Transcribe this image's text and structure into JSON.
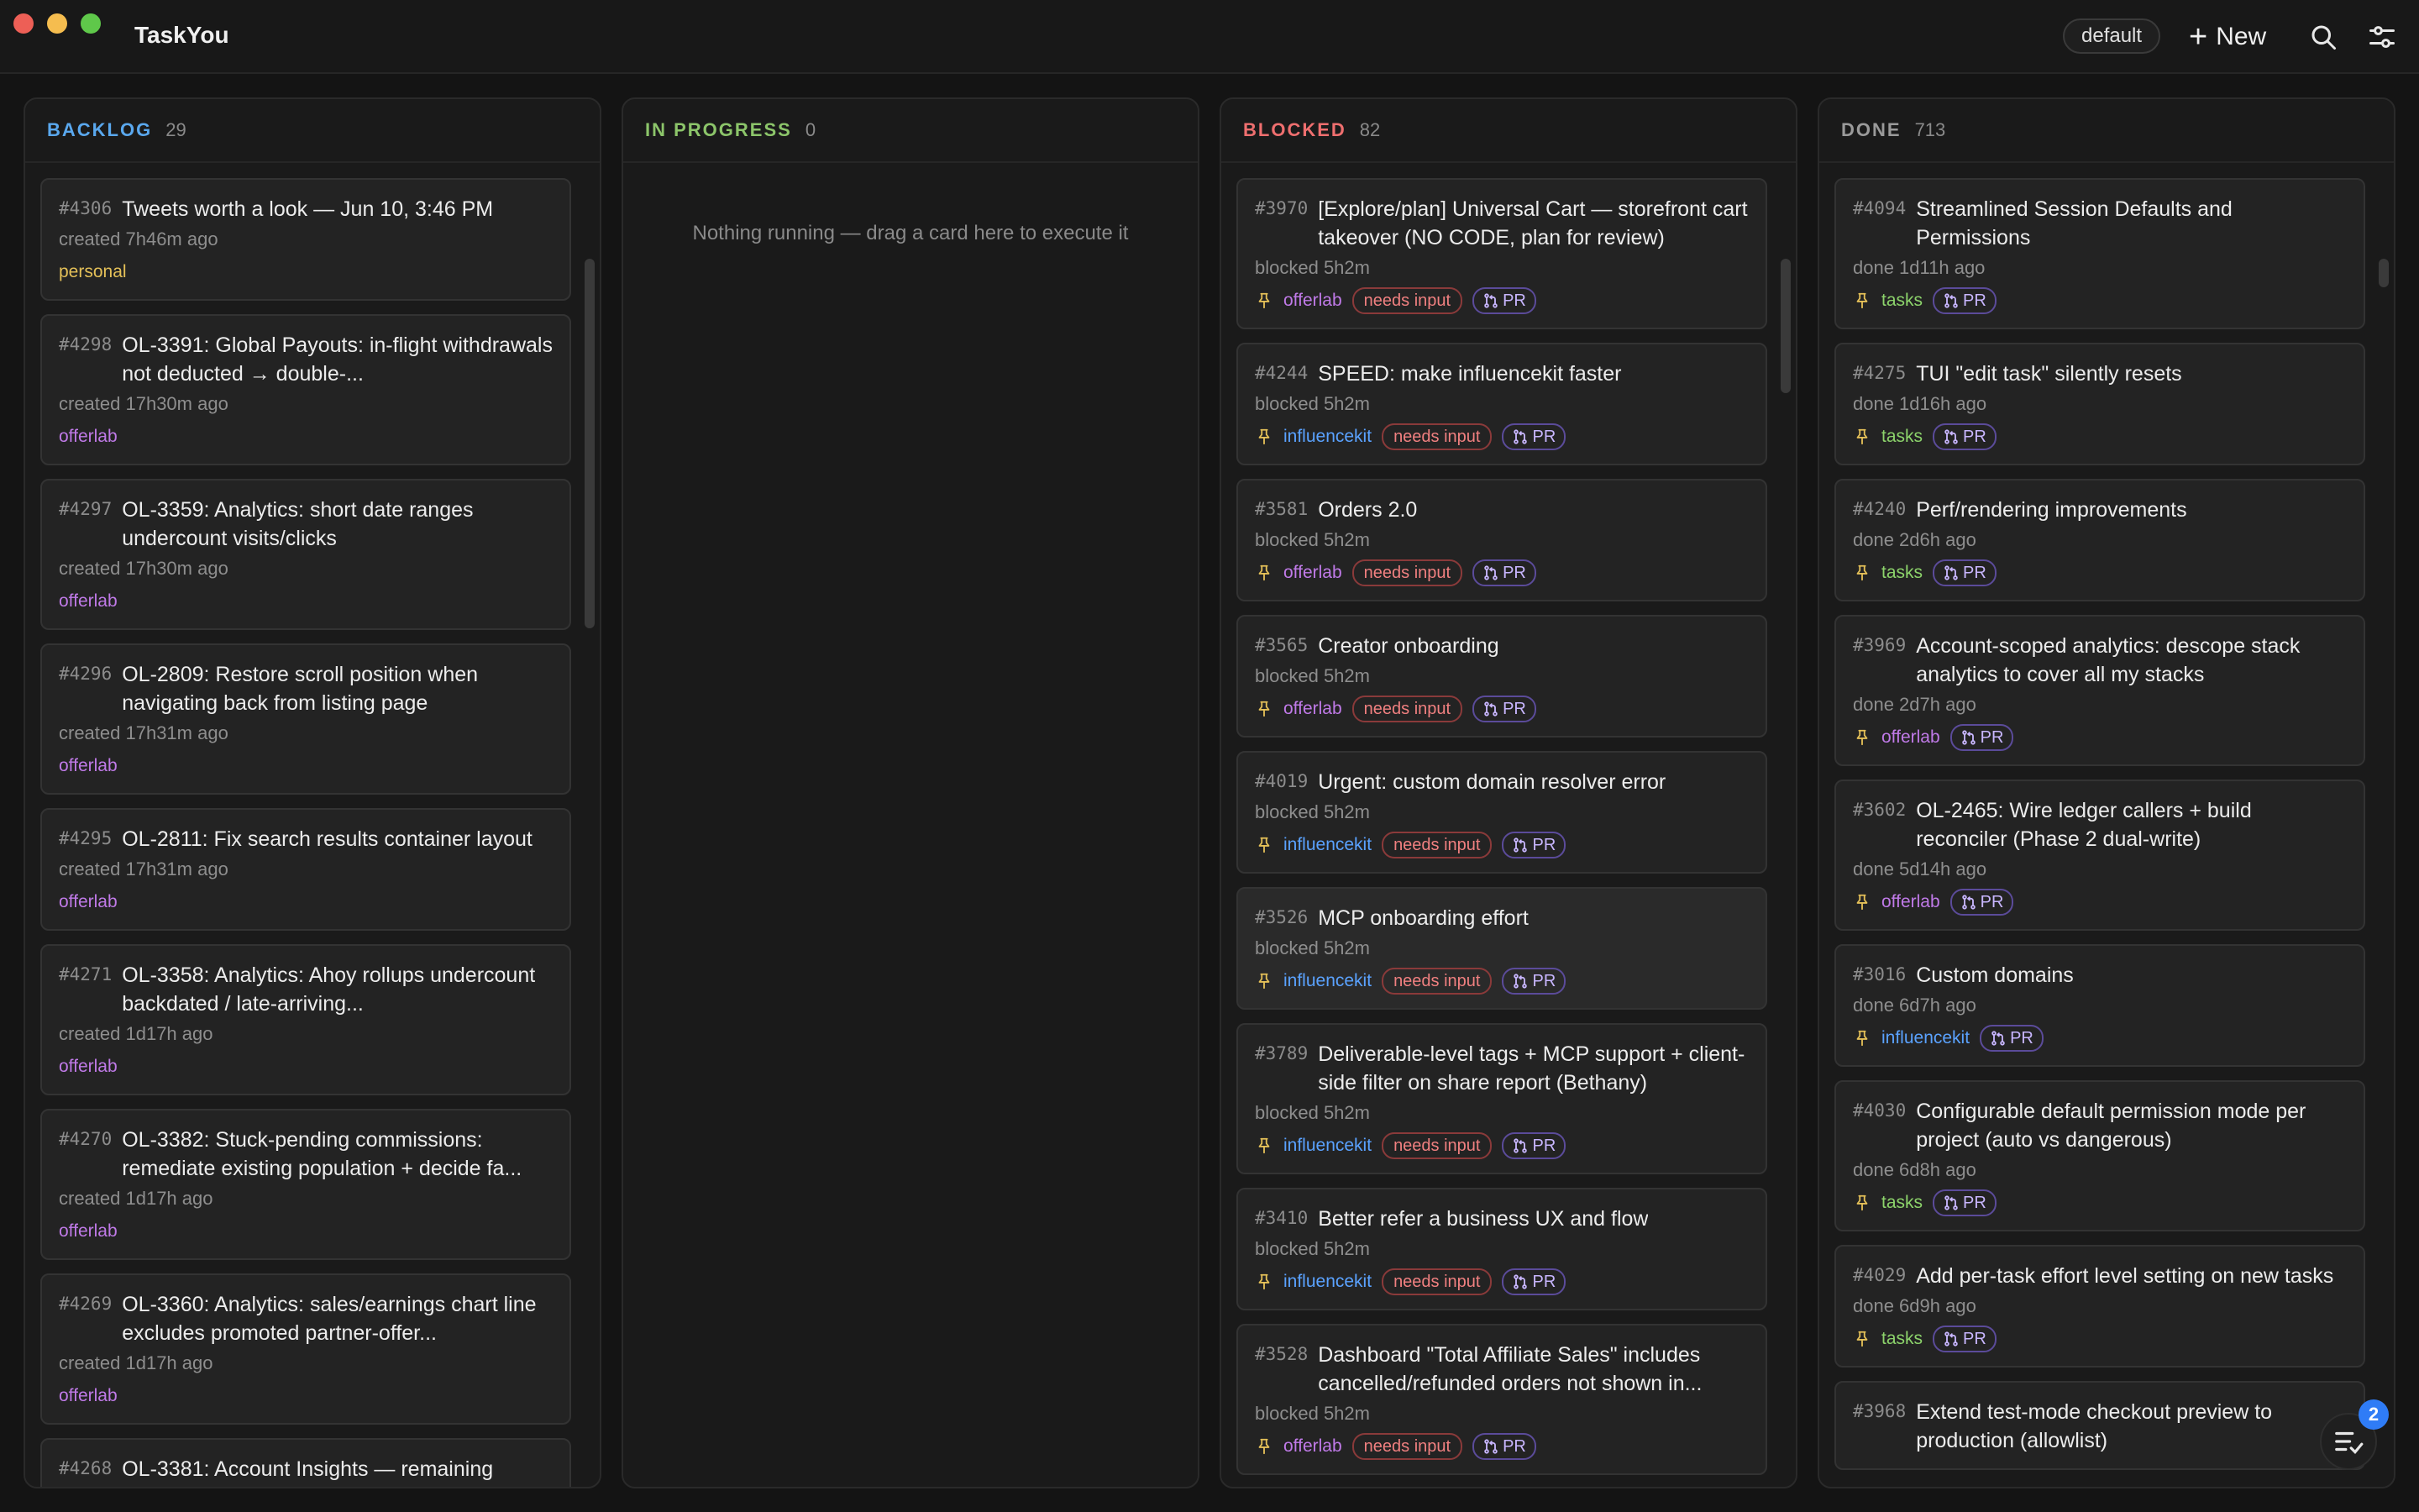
{
  "app": {
    "title": "TaskYou"
  },
  "toolbar": {
    "profile": "default",
    "new_label": "New"
  },
  "columns": {
    "backlog": {
      "title": "BACKLOG",
      "count": "29",
      "color": "#5aa8ee",
      "cards": [
        {
          "id": "#4306",
          "title": "Tweets worth a look — Jun 10, 3:46 PM",
          "meta": "created 7h46m ago",
          "project": "personal"
        },
        {
          "id": "#4298",
          "title": "OL-3391: Global Payouts: in-flight withdrawals not deducted → double-...",
          "meta": "created 17h30m ago",
          "project": "offerlab"
        },
        {
          "id": "#4297",
          "title": "OL-3359: Analytics: short date ranges undercount visits/clicks",
          "meta": "created 17h30m ago",
          "project": "offerlab"
        },
        {
          "id": "#4296",
          "title": "OL-2809: Restore scroll position when navigating back from listing page",
          "meta": "created 17h31m ago",
          "project": "offerlab"
        },
        {
          "id": "#4295",
          "title": "OL-2811: Fix search results container layout",
          "meta": "created 17h31m ago",
          "project": "offerlab"
        },
        {
          "id": "#4271",
          "title": "OL-3358: Analytics: Ahoy rollups undercount backdated / late-arriving...",
          "meta": "created 1d17h ago",
          "project": "offerlab"
        },
        {
          "id": "#4270",
          "title": "OL-3382: Stuck-pending commissions: remediate existing population + decide fa...",
          "meta": "created 1d17h ago",
          "project": "offerlab"
        },
        {
          "id": "#4269",
          "title": "OL-3360: Analytics: sales/earnings chart line excludes promoted partner-offer...",
          "meta": "created 1d17h ago",
          "project": "offerlab"
        },
        {
          "id": "#4268",
          "title": "OL-3381: Account Insights — remaining",
          "meta": "",
          "project": ""
        }
      ]
    },
    "in_progress": {
      "title": "IN PROGRESS",
      "count": "0",
      "color": "#8cc56a",
      "empty": "Nothing running — drag a card here to execute it"
    },
    "blocked": {
      "title": "BLOCKED",
      "count": "82",
      "color": "#ef6f6f",
      "needs_input_label": "needs input",
      "pr_label": "PR",
      "cards": [
        {
          "id": "#3970",
          "title": "[Explore/plan] Universal Cart — storefront cart takeover (NO CODE, plan for review)",
          "meta": "blocked 5h2m",
          "project": "offerlab"
        },
        {
          "id": "#4244",
          "title": "SPEED: make influencekit faster",
          "meta": "blocked 5h2m",
          "project": "influencekit"
        },
        {
          "id": "#3581",
          "title": "Orders 2.0",
          "meta": "blocked 5h2m",
          "project": "offerlab"
        },
        {
          "id": "#3565",
          "title": "Creator onboarding",
          "meta": "blocked 5h2m",
          "project": "offerlab"
        },
        {
          "id": "#4019",
          "title": "Urgent: custom domain resolver error",
          "meta": "blocked 5h2m",
          "project": "influencekit"
        },
        {
          "id": "#3526",
          "title": "MCP onboarding effort",
          "meta": "blocked 5h2m",
          "project": "influencekit"
        },
        {
          "id": "#3789",
          "title": "Deliverable-level tags + MCP support + client-side filter on share report (Bethany)",
          "meta": "blocked 5h2m",
          "project": "influencekit"
        },
        {
          "id": "#3410",
          "title": "Better refer a business UX and flow",
          "meta": "blocked 5h2m",
          "project": "influencekit"
        },
        {
          "id": "#3528",
          "title": "Dashboard \"Total Affiliate Sales\" includes cancelled/refunded orders not shown in...",
          "meta": "blocked 5h2m",
          "project": "offerlab"
        }
      ]
    },
    "done": {
      "title": "DONE",
      "count": "713",
      "color": "#9a9a9a",
      "pr_label": "PR",
      "cards": [
        {
          "id": "#4094",
          "title": "Streamlined Session Defaults and Permissions",
          "meta": "done 1d11h ago",
          "project": "tasks"
        },
        {
          "id": "#4275",
          "title": "TUI \"edit task\" silently resets",
          "meta": "done 1d16h ago",
          "project": "tasks"
        },
        {
          "id": "#4240",
          "title": "Perf/rendering improvements",
          "meta": "done 2d6h ago",
          "project": "tasks"
        },
        {
          "id": "#3969",
          "title": "Account-scoped analytics: descope stack analytics to cover all my stacks",
          "meta": "done 2d7h ago",
          "project": "offerlab"
        },
        {
          "id": "#3602",
          "title": "OL-2465: Wire ledger callers + build reconciler (Phase 2 dual-write)",
          "meta": "done 5d14h ago",
          "project": "offerlab"
        },
        {
          "id": "#3016",
          "title": "Custom domains",
          "meta": "done 6d7h ago",
          "project": "influencekit"
        },
        {
          "id": "#4030",
          "title": "Configurable default permission mode per project (auto vs dangerous)",
          "meta": "done 6d8h ago",
          "project": "tasks"
        },
        {
          "id": "#4029",
          "title": "Add per-task effort level setting on new tasks",
          "meta": "done 6d9h ago",
          "project": "tasks"
        },
        {
          "id": "#3968",
          "title": "Extend test-mode checkout preview to production (allowlist)",
          "meta": "",
          "project": ""
        }
      ]
    }
  },
  "fab": {
    "badge": "2"
  },
  "icons": {
    "search": "search-icon",
    "settings": "sliders-icon",
    "pin": "pin-icon",
    "pr": "git-pull-request-icon",
    "queue": "queue-list-icon"
  }
}
